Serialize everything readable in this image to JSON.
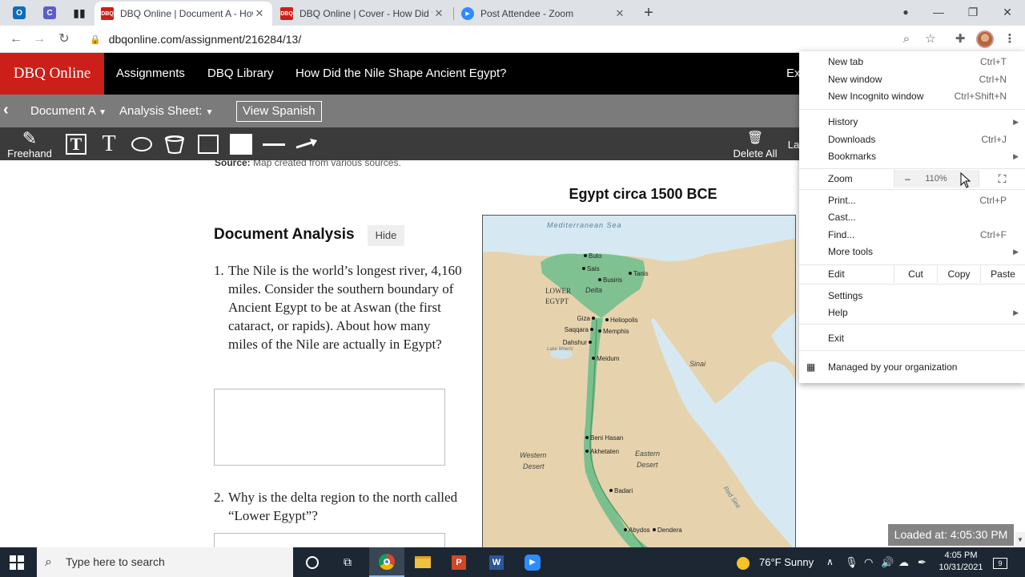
{
  "browser": {
    "tabs": [
      {
        "title": "DBQ Online | Document A - How",
        "active": true
      },
      {
        "title": "DBQ Online | Cover - How Did th",
        "active": false
      },
      {
        "title": "Post Attendee - Zoom",
        "active": false
      }
    ],
    "url": "dbqonline.com/assignment/216284/13/"
  },
  "site": {
    "brand": "DBQ Online",
    "nav": {
      "assignments": "Assignments",
      "library": "DBQ Library",
      "title": "How Did the Nile Shape Ancient Egypt?",
      "exit_partial": "Ex"
    },
    "subnav": {
      "document": "Document A",
      "sheet": "Analysis Sheet:",
      "view_spanish": "View Spanish"
    },
    "toolbar": {
      "freehand": "Freehand",
      "delete_all": "Delete All",
      "right_partial": "La"
    }
  },
  "content": {
    "source_label": "Source:",
    "source_text": "Map created from various sources.",
    "analysis_title": "Document Analysis",
    "hide_label": "Hide",
    "q1_num": "1.",
    "q1_text": "The Nile is the world’s longest river, 4,160 miles. Consider the southern boundary of Ancient Egypt to be at Aswan (the first cataract, or rapids). About how many miles of the Nile are actually in Egypt?",
    "q2_num": "2.",
    "q2_text": "Why is the delta region to the north called “Lower Egypt”?",
    "map_title": "Egypt circa 1500 BCE",
    "map_labels": {
      "sea": "Mediterranean Sea",
      "lower": "LOWER",
      "egypt": "EGYPT",
      "delta": "Delta",
      "sinai": "Sinai",
      "western1": "Western",
      "western2": "Desert",
      "eastern1": "Eastern",
      "eastern2": "Desert",
      "redsea": "Red Sea",
      "lake": "Lake Moeris"
    },
    "cities": [
      "Buto",
      "Sais",
      "Busiris",
      "Tanis",
      "Giza",
      "Heliopolis",
      "Saqqara",
      "Memphis",
      "Dahshur",
      "Meidum",
      "Beni Hasan",
      "Akhetaten",
      "Badari",
      "Abydos",
      "Dendera"
    ]
  },
  "menu": {
    "new_tab": "New tab",
    "new_tab_sc": "Ctrl+T",
    "new_window": "New window",
    "new_window_sc": "Ctrl+N",
    "incognito": "New Incognito window",
    "incognito_sc": "Ctrl+Shift+N",
    "history": "History",
    "downloads": "Downloads",
    "downloads_sc": "Ctrl+J",
    "bookmarks": "Bookmarks",
    "zoom": "Zoom",
    "zoom_minus": "–",
    "zoom_value": "110%",
    "print": "Print...",
    "print_sc": "Ctrl+P",
    "cast": "Cast...",
    "find": "Find...",
    "find_sc": "Ctrl+F",
    "more_tools": "More tools",
    "edit": "Edit",
    "cut": "Cut",
    "copy": "Copy",
    "paste": "Paste",
    "settings": "Settings",
    "help": "Help",
    "exit": "Exit",
    "managed": "Managed by your organization"
  },
  "overlay": {
    "loaded": "Loaded at: 4:05:30 PM"
  },
  "taskbar": {
    "search_placeholder": "Type here to search",
    "weather": "76°F  Sunny",
    "time": "4:05 PM",
    "date": "10/31/2021",
    "notifications": "9"
  }
}
